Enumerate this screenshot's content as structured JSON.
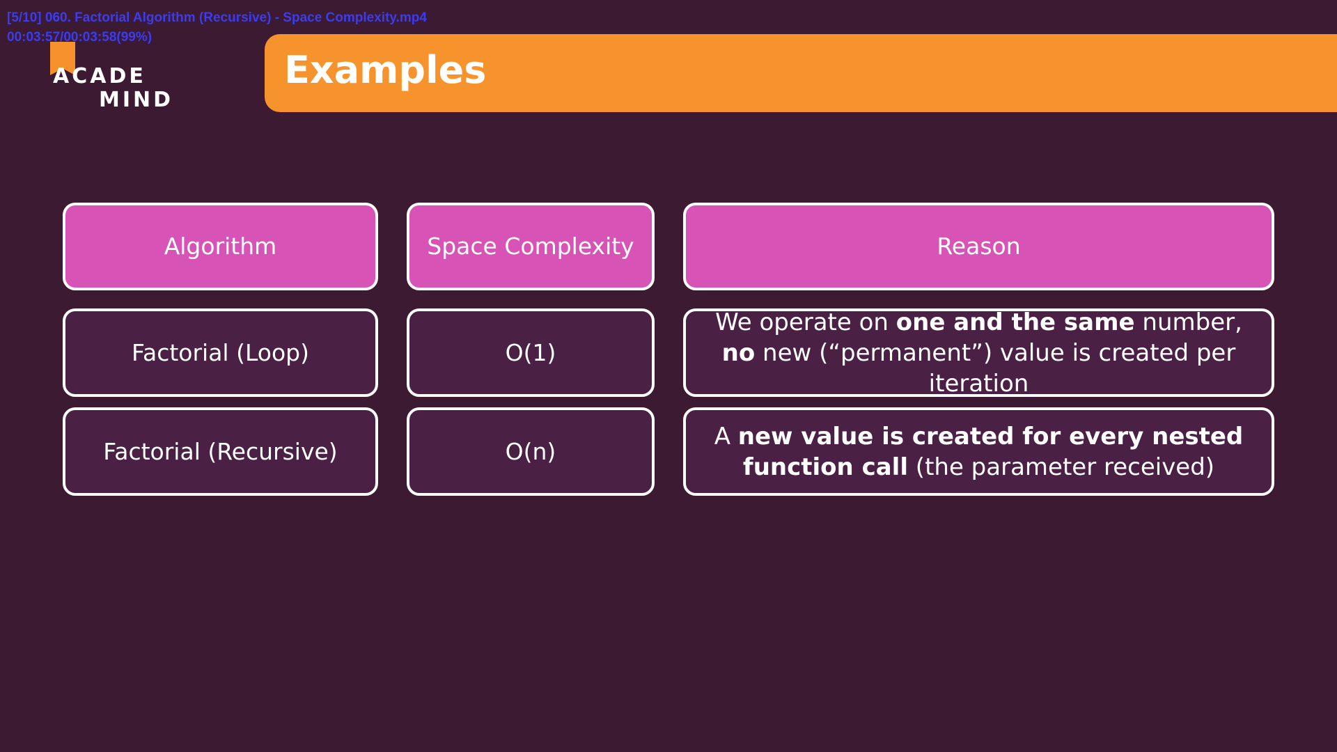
{
  "player": {
    "file_title": "[5/10] 060. Factorial Algorithm (Recursive) - Space Complexity.mp4",
    "time": "00:03:57/00:03:58(99%)"
  },
  "logo": {
    "line1": "ACADE",
    "line2": "MIND"
  },
  "slide": {
    "title": "Examples"
  },
  "table": {
    "headers": [
      "Algorithm",
      "Space Complexity",
      "Reason"
    ],
    "rows": [
      {
        "algorithm": "Factorial (Loop)",
        "complexity": "O(1)",
        "reason": {
          "t1": "We operate on ",
          "b1": "one and the same",
          "t2": " number, ",
          "b2": "no",
          "t3": " new (“permanent”) value is created per iteration"
        }
      },
      {
        "algorithm": "Factorial (Recursive)",
        "complexity": "O(n)",
        "reason": {
          "t1": "A ",
          "b1": "new value is created for every nested function call",
          "t2": " (the parameter received)"
        }
      }
    ]
  },
  "colors": {
    "background": "#3c1a31",
    "banner": "#f7932c",
    "header_cell": "#d753b6",
    "body_cell": "#4a2045",
    "overlay_text": "#3a3cf0"
  }
}
